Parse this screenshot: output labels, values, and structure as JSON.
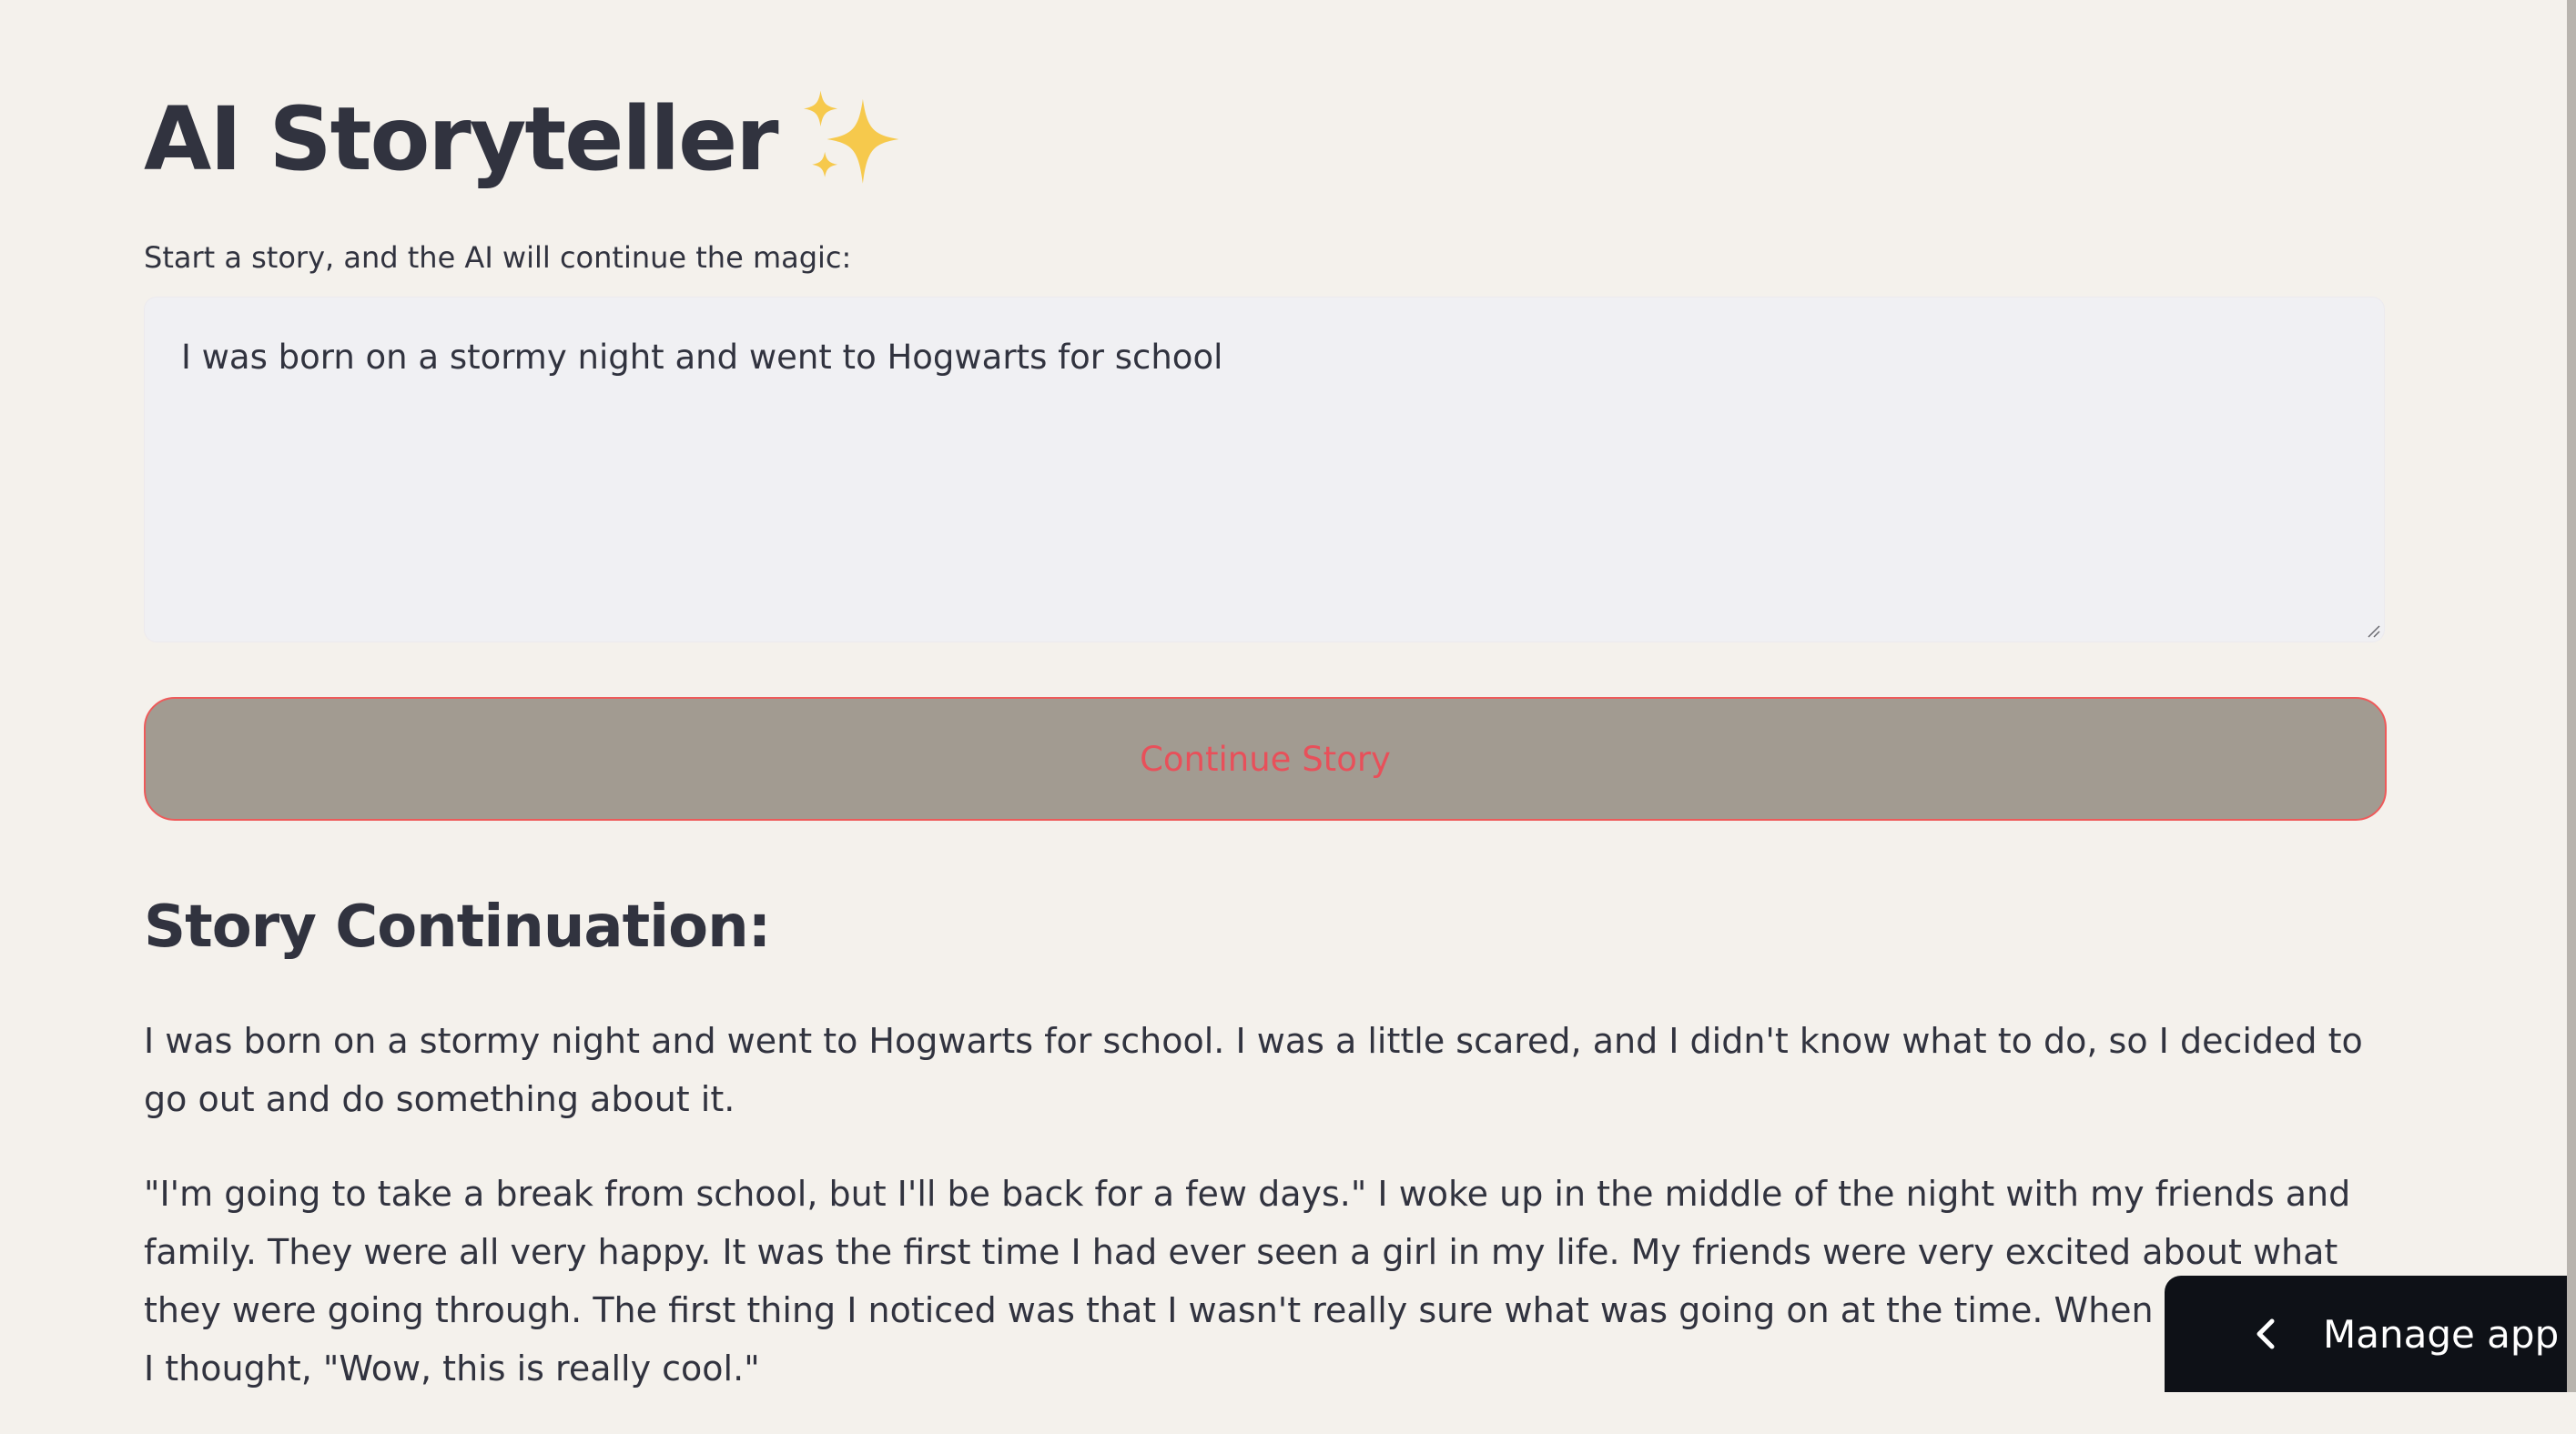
{
  "app": {
    "title": "AI Storyteller",
    "title_icon": "sparkles-icon"
  },
  "input": {
    "label": "Start a story, and the AI will continue the magic:",
    "value": "I was born on a stormy night and went to Hogwarts for school"
  },
  "button": {
    "label": "Continue Story"
  },
  "output": {
    "heading": "Story Continuation:",
    "paragraphs": [
      "I was born on a stormy night and went to Hogwarts for school. I was a little scared, and I didn't know what to do, so I decided to go out and do something about it.",
      "\"I'm going to take a break from school, but I'll be back for a few days.\" I woke up in the middle of the night with my friends and family. They were all very happy. It was the first time I had ever seen a girl in my life. My friends were very excited about what they were going through. The first thing I noticed was that I wasn't really sure what was going on at the time. When I saw them, I thought, \"Wow, this is really cool.\""
    ]
  },
  "manage": {
    "label": "Manage app",
    "icon": "chevron-left-icon"
  },
  "colors": {
    "background": "#f4f1ec",
    "text": "#31333f",
    "button_bg": "#a29b91",
    "button_text": "#e8505a",
    "manage_bg": "#0e1117"
  }
}
